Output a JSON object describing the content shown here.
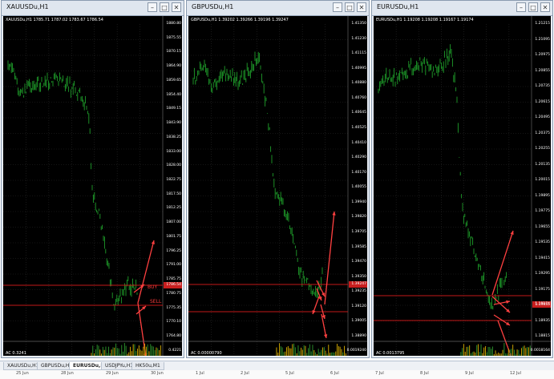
{
  "windows": [
    {
      "title": "XAUUSDu,H1",
      "symbol_info": "XAUUSDu,H1  1785.71 1787.02 1783.67 1786.54",
      "ac_label": "AC  0.3241",
      "price_ticks": [
        "1880.80",
        "1875.55",
        "1870.15",
        "1864.90",
        "1859.65",
        "1854.40",
        "1849.15",
        "1843.90",
        "1838.25",
        "1833.00",
        "1828.00",
        "1822.75",
        "1817.50",
        "1812.25",
        "1807.00",
        "1801.75",
        "1796.25",
        "1791.00",
        "1785.75",
        "1780.75",
        "1775.35",
        "1770.10",
        "1764.80"
      ],
      "red_label": "1786.54",
      "ac_tick": "0.4221",
      "annotations": [
        "BUY",
        "SELL"
      ]
    },
    {
      "title": "GBPUSDu,H1",
      "symbol_info": "GBPUSDu,H1  1.39202 1.39266 1.39196 1.39247",
      "ac_label": "AC  0.00000790",
      "price_ticks": [
        "1.41350",
        "1.41230",
        "1.41115",
        "1.40995",
        "1.40880",
        "1.40760",
        "1.40645",
        "1.40525",
        "1.40410",
        "1.40290",
        "1.40170",
        "1.40055",
        "1.39940",
        "1.39820",
        "1.39705",
        "1.39585",
        "1.39470",
        "1.39350",
        "1.39235",
        "1.39120",
        "1.39005",
        "1.38890"
      ],
      "red_label": "1.39247",
      "ac_tick": "0.0019240",
      "annotations": []
    },
    {
      "title": "EURUSDu,H1",
      "symbol_info": "EURUSDu,H1  1.19208 1.19208 1.19167 1.19174",
      "ac_label": "AC  0.0013795",
      "price_ticks": [
        "1.21215",
        "1.21095",
        "1.20975",
        "1.20855",
        "1.20735",
        "1.20615",
        "1.20495",
        "1.20375",
        "1.20255",
        "1.20135",
        "1.20015",
        "1.19895",
        "1.19775",
        "1.19655",
        "1.19535",
        "1.19415",
        "1.19295",
        "1.19175",
        "1.19055",
        "1.18935",
        "1.18815"
      ],
      "red_label": "1.19174",
      "ac_tick": "0.0018164",
      "annotations": []
    }
  ],
  "tabs": [
    "XAUUSDu,H1",
    "GBPUSDu,H1",
    "EURUSDu,H1",
    "USDJPYu,H1",
    "HK50u,M1"
  ],
  "active_tab": 2,
  "bottom_labels": [
    "25 Jun",
    "28 Jun",
    "29 Jun",
    "30 Jun",
    "1 Jul",
    "2 Jul",
    "5 Jul",
    "6 Jul",
    "7 Jul",
    "8 Jul",
    "9 Jul",
    "12 Jul"
  ],
  "colors": {
    "candle": "#1e9e2a",
    "grid": "#2a2a2a",
    "level": "#c21818",
    "arrow": "#ff4040",
    "ac_bar": "#c8a000"
  }
}
